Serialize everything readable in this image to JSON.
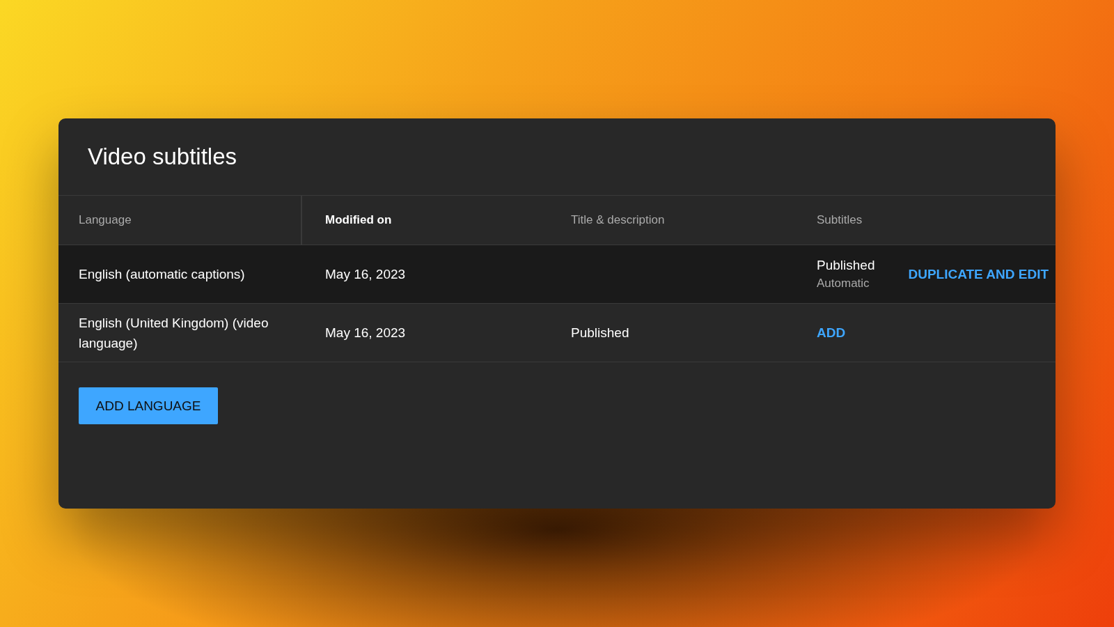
{
  "panel": {
    "title": "Video subtitles"
  },
  "table": {
    "columns": [
      {
        "label": "Language",
        "sorted": false
      },
      {
        "label": "Modified on",
        "sorted": true
      },
      {
        "label": "Title & description",
        "sorted": false
      },
      {
        "label": "Subtitles",
        "sorted": false
      }
    ],
    "rows": [
      {
        "highlighted": true,
        "language": "English (automatic captions)",
        "modified_on": "May 16, 2023",
        "subtitles": {
          "kind": "status",
          "status": "Published",
          "detail": "Automatic"
        },
        "action": "DUPLICATE AND EDIT"
      },
      {
        "highlighted": false,
        "language": "English (United Kingdom) (video language)",
        "modified_on": "May 16, 2023",
        "title_description": "Published",
        "subtitles": {
          "kind": "link",
          "label": "ADD"
        }
      }
    ]
  },
  "add_language_button": "ADD LANGUAGE"
}
